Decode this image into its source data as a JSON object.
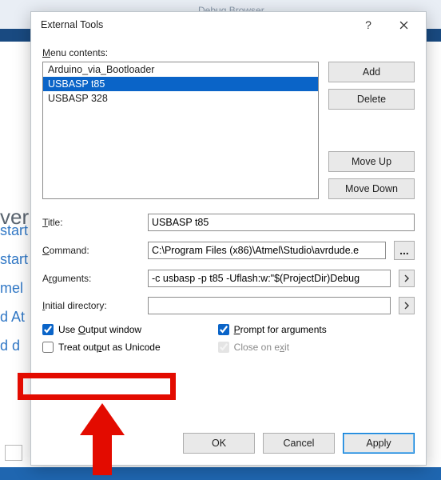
{
  "bg": {
    "tab_hint": "Debug Browser",
    "ver": "ver",
    "lines": "start\nstart\nmel\nd At\nd d"
  },
  "dialog": {
    "title": "External Tools",
    "menu_contents_label": "Menu contents:",
    "menu_items": [
      {
        "label": "Arduino_via_Bootloader",
        "selected": false
      },
      {
        "label": "USBASP t85",
        "selected": true
      },
      {
        "label": "USBASP 328",
        "selected": false
      }
    ],
    "buttons": {
      "add": "Add",
      "delete": "Delete",
      "move_up": "Move Up",
      "move_down": "Move Down",
      "ok": "OK",
      "cancel": "Cancel",
      "apply": "Apply"
    },
    "fields": {
      "title_label": "Title:",
      "title_value": "USBASP t85",
      "command_label": "Command:",
      "command_value": "C:\\Program Files (x86)\\Atmel\\Studio\\avrdude.e",
      "arguments_label": "Arguments:",
      "arguments_value": "-c usbasp -p t85 -Uflash:w:\"$(ProjectDir)Debug",
      "initial_dir_label": "Initial directory:",
      "initial_dir_value": ""
    },
    "checks": {
      "use_output_window": {
        "label": "Use Output window",
        "checked": true
      },
      "treat_as_unicode": {
        "label": "Treat output as Unicode",
        "checked": false
      },
      "prompt_for_args": {
        "label": "Prompt for arguments",
        "checked": true
      },
      "close_on_exit": {
        "label": "Close on exit",
        "checked": true,
        "disabled": true
      }
    },
    "browse": "..."
  }
}
